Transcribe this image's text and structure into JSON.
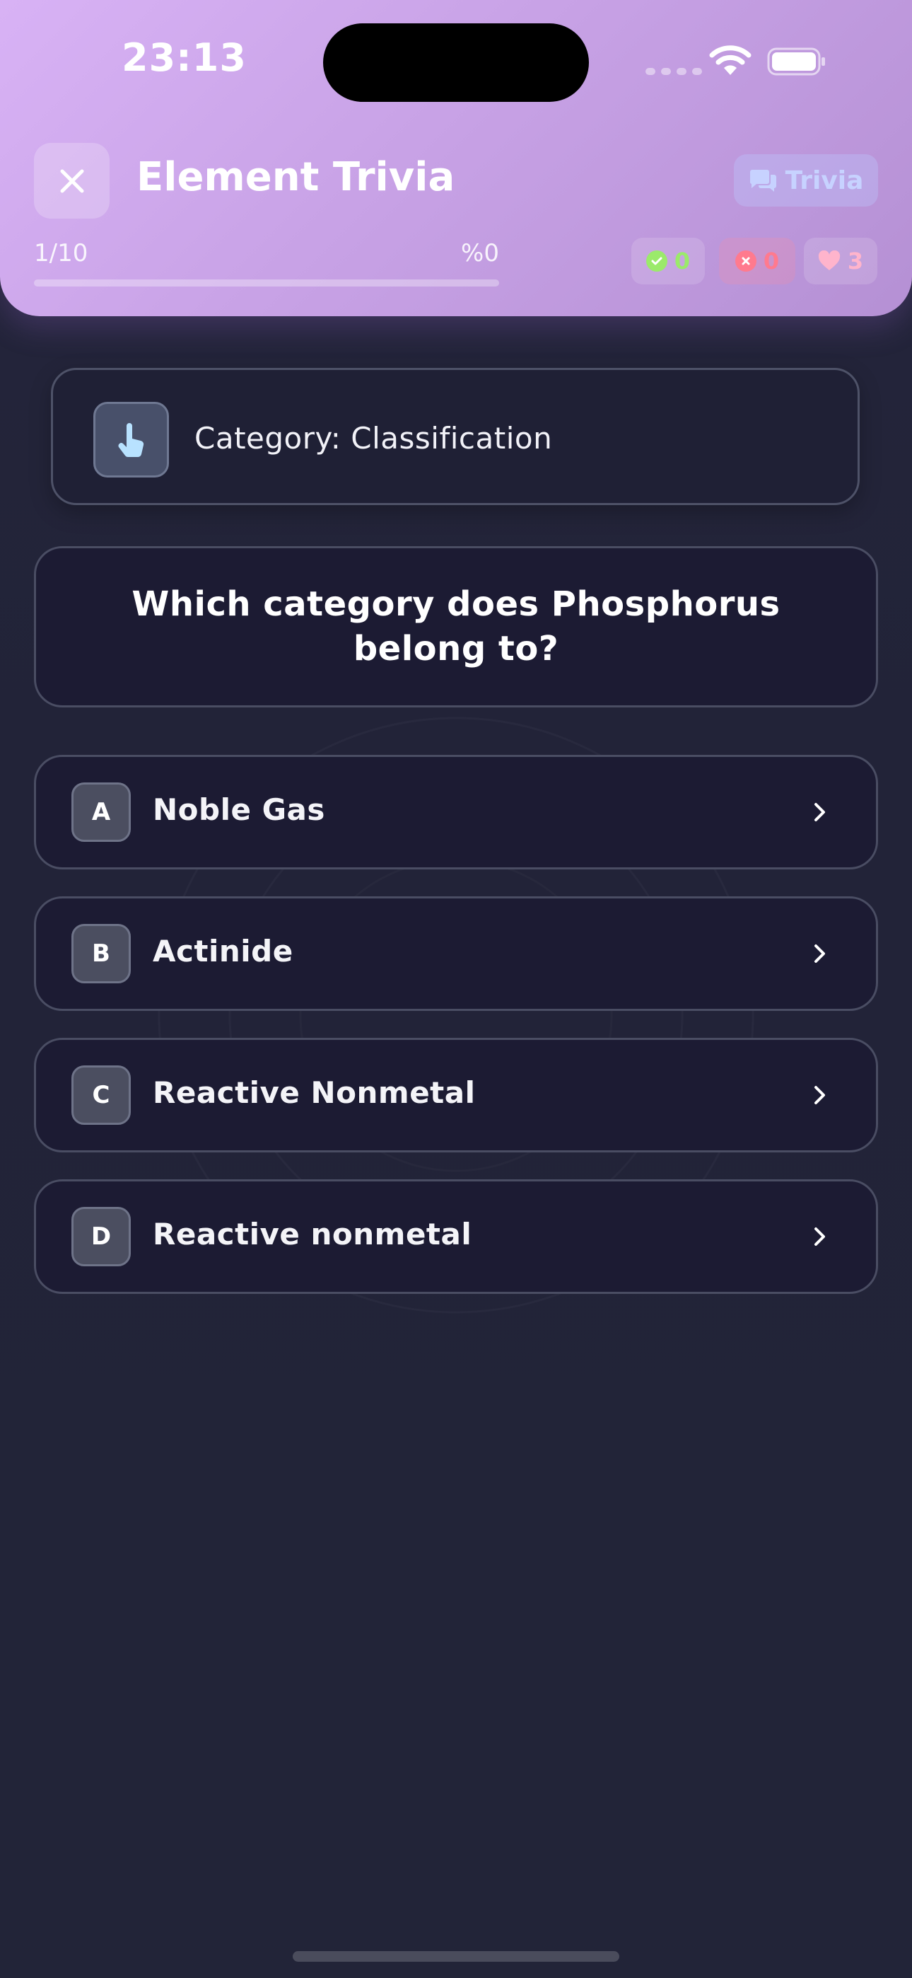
{
  "status_bar": {
    "time": "23:13"
  },
  "header": {
    "title": "Element Trivia",
    "mode_badge": "Trivia",
    "progress_count": "1/10",
    "progress_percent": "%0",
    "progress_fraction": 0,
    "stats": {
      "correct": "0",
      "wrong": "0",
      "lives": "3"
    }
  },
  "category": {
    "label": "Category: Classification"
  },
  "question": {
    "text": "Which category does Phosphorus belong to?"
  },
  "answers": [
    {
      "letter": "A",
      "text": "Noble Gas"
    },
    {
      "letter": "B",
      "text": "Actinide"
    },
    {
      "letter": "C",
      "text": "Reactive Nonmetal"
    },
    {
      "letter": "D",
      "text": "Reactive nonmetal"
    }
  ],
  "colors": {
    "header_gradient_start": "#d8b2f5",
    "header_gradient_end": "#b590d4",
    "background": "#22243a",
    "card": "#1c1b33",
    "correct": "#9bea6b",
    "wrong": "#ff7a8e",
    "lives": "#ffb4cc"
  }
}
